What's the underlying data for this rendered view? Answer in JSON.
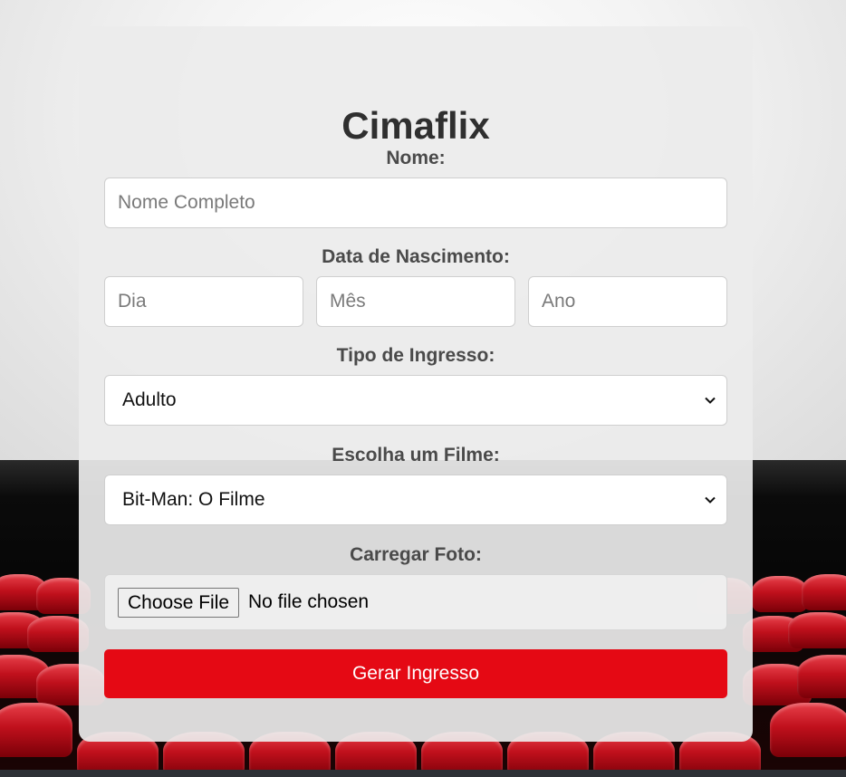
{
  "app": {
    "title": "Cimaflix"
  },
  "form": {
    "name": {
      "label": "Nome:",
      "placeholder": "Nome Completo",
      "value": ""
    },
    "birthdate": {
      "label": "Data de Nascimento:",
      "day_placeholder": "Dia",
      "month_placeholder": "Mês",
      "year_placeholder": "Ano"
    },
    "ticket_type": {
      "label": "Tipo de Ingresso:",
      "selected": "Adulto"
    },
    "movie": {
      "label": "Escolha um Filme:",
      "selected": "Bit-Man: O Filme"
    },
    "photo": {
      "label": "Carregar Foto:",
      "button_label": "Choose File",
      "status": "No file chosen"
    },
    "submit_label": "Gerar Ingresso"
  },
  "colors": {
    "accent": "#e50914",
    "card": "#ebebeb",
    "text": "#2f2f2f"
  },
  "icons": {
    "select_arrow": "chevron-down-icon"
  }
}
